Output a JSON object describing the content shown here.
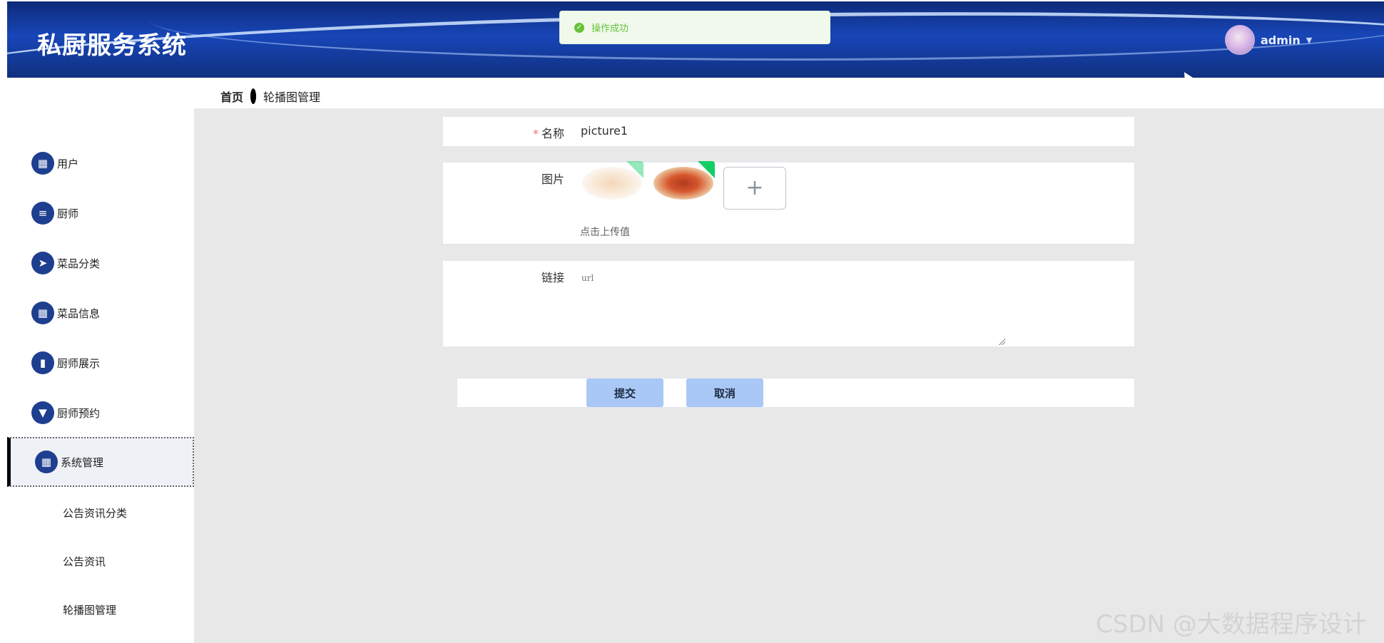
{
  "header": {
    "title": "私厨服务系统",
    "username": "admin",
    "caret": "▼"
  },
  "toast": {
    "icon": "check-circle-icon",
    "message": "操作成功"
  },
  "breadcrumb": {
    "home": "首页",
    "current": "轮播图管理"
  },
  "sidebar": {
    "items": [
      {
        "label": "用户",
        "icon": "grid-icon",
        "glyph": "▦"
      },
      {
        "label": "厨师",
        "icon": "list-icon",
        "glyph": "≡"
      },
      {
        "label": "菜品分类",
        "icon": "send-icon",
        "glyph": "➤"
      },
      {
        "label": "菜品信息",
        "icon": "apps-icon",
        "glyph": "▦"
      },
      {
        "label": "厨师展示",
        "icon": "bar-chart-icon",
        "glyph": "▮"
      },
      {
        "label": "厨师预约",
        "icon": "pin-icon",
        "glyph": "▼"
      },
      {
        "label": "系统管理",
        "icon": "apps-icon",
        "glyph": "▦"
      }
    ],
    "sub_items": [
      {
        "label": "公告资讯分类"
      },
      {
        "label": "公告资讯"
      },
      {
        "label": "轮播图管理"
      }
    ]
  },
  "form": {
    "name_label": "名称",
    "name_required_mark": "*",
    "name_value": "picture1",
    "image_label": "图片",
    "upload_plus": "+",
    "upload_hint": "点击上传值",
    "link_label": "链接",
    "link_placeholder": "url",
    "submit_label": "提交",
    "cancel_label": "取消"
  },
  "watermark": "CSDN @大数据程序设计",
  "colors": {
    "header_bg": "#1846b8",
    "menu_icon_bg": "#1e3f8f",
    "button_bg": "#a9c8f5",
    "success": "#67c23a",
    "content_bg": "#e8e8e8"
  }
}
